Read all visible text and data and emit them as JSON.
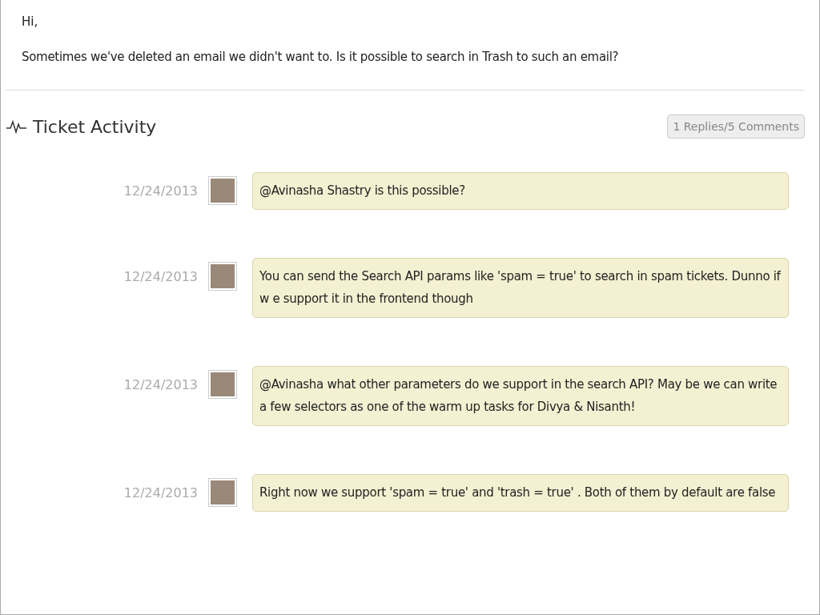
{
  "description": {
    "greeting": "Hi,",
    "body": "Sometimes we've deleted an email we didn't want to. Is it possible to search in Trash to such an email?"
  },
  "activity": {
    "title": "Ticket Activity",
    "counts": "1 Replies/5 Comments",
    "comments": [
      {
        "date": "12/24/2013",
        "text": "@Avinasha Shastry is this possible?"
      },
      {
        "date": "12/24/2013",
        "text": "You can send the Search API params like 'spam = true' to search in spam tickets. Dunno if w e support it in the frontend though"
      },
      {
        "date": "12/24/2013",
        "text": "@Avinasha what other parameters do we support in the search API? May be we can write a few selectors as one of the warm up tasks for Divya & Nisanth!"
      },
      {
        "date": "12/24/2013",
        "text": "Right now we support 'spam = true' and 'trash = true' . Both of them by default are false"
      }
    ]
  }
}
